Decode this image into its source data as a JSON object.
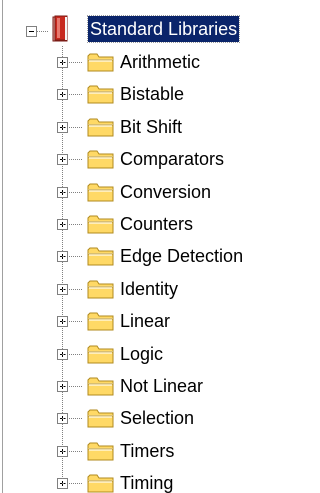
{
  "root": {
    "label": "Standard Libraries",
    "icon": "library-book-icon",
    "expanded": true,
    "selected": true
  },
  "children": [
    {
      "label": "Arithmetic",
      "icon": "folder-icon",
      "expanded": false
    },
    {
      "label": "Bistable",
      "icon": "folder-icon",
      "expanded": false
    },
    {
      "label": "Bit Shift",
      "icon": "folder-icon",
      "expanded": false
    },
    {
      "label": "Comparators",
      "icon": "folder-icon",
      "expanded": false
    },
    {
      "label": "Conversion",
      "icon": "folder-icon",
      "expanded": false
    },
    {
      "label": "Counters",
      "icon": "folder-icon",
      "expanded": false
    },
    {
      "label": "Edge Detection",
      "icon": "folder-icon",
      "expanded": false
    },
    {
      "label": "Identity",
      "icon": "folder-icon",
      "expanded": false
    },
    {
      "label": "Linear",
      "icon": "folder-icon",
      "expanded": false
    },
    {
      "label": "Logic",
      "icon": "folder-icon",
      "expanded": false
    },
    {
      "label": "Not Linear",
      "icon": "folder-icon",
      "expanded": false
    },
    {
      "label": "Selection",
      "icon": "folder-icon",
      "expanded": false
    },
    {
      "label": "Timers",
      "icon": "folder-icon",
      "expanded": false
    },
    {
      "label": "Timing",
      "icon": "folder-icon",
      "expanded": false
    }
  ],
  "colors": {
    "selection_bg": "#0a246a",
    "selection_text": "#ffffff",
    "folder_fill": "#ffd966",
    "folder_stroke": "#b08a1e",
    "book_red": "#c8281e"
  }
}
